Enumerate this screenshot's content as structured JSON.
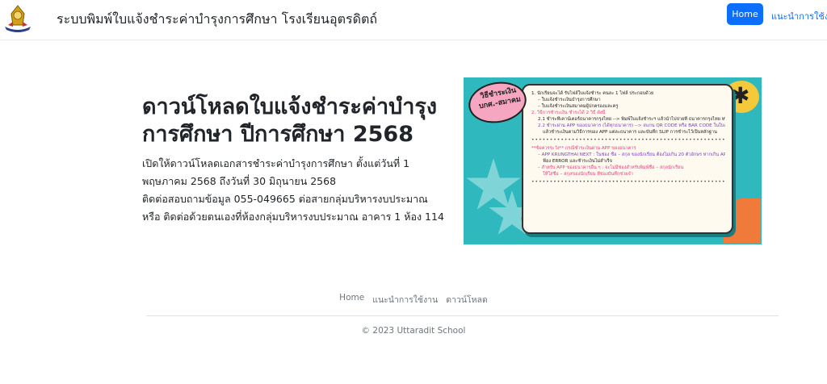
{
  "header": {
    "site_title": "ระบบพิมพ์ใบแจ้งชำระค่าบำรุงการศึกษา โรงเรียนอุตรดิตถ์",
    "nav": {
      "home": "Home",
      "guide": "แนะนำการใช้งาน"
    }
  },
  "hero": {
    "title": "ดาวน์โหลดใบแจ้งชำระค่าบำรุงการศึกษา ปีการศึกษา 2568",
    "description": [
      "เปิดให้ดาวน์โหลดเอกสารชำระค่าบำรุงการศึกษา ตั้งแต่วันที่ 1 พฤษภาคม 2568 ถึงวันที่ 30 มิถุนายน 2568",
      "ติดต่อสอบถามข้อมูล 055-049665 ต่อสายกลุ่มบริหารงบประมาณ หรือ ติดต่อด้วยตนเองที่ห้องกลุ่มบริหารงบประมาณ อาคาร 1 ห้อง 114"
    ]
  },
  "banner": {
    "bubble": "วิธีชำระเงิน บกศ.-สมาคม",
    "lines": [
      "1. นักเรียนจะได้ รับไฟล์ใบแจ้งชำระ คนละ 1 ไฟล์ ประกอบด้วย",
      "– ใบแจ้งชำระเงินบำรุงการศึกษา",
      "– ใบแจ้งชำระเงินสมาคมผู้ปกครองและครู",
      "2. วิธีการชำระเงิน ชำระได้ 2 วิธี ดังนี้",
      "2.1 ชำระที่เคาน์เตอร์ธนาคารกรุงไทย --> พิมพ์ใบแจ้งชำระฯ แล้วนำไปจ่ายที่ ธนาคารกรุงไทย หรือ",
      "2.2 ชำระผ่าน APP ของธนาคาร (ได้ทุกธนาคาร) --> สแกน QR CODE หรือ BAR CODE ในใบแจ้งฯ",
      "แล้วชำระเงินตามวิธีการของ APP แต่ละธนาคาร และบันทึก SLIP การชำระไว้เป็นหลักฐาน",
      "**ข้อควรระวัง** กรณีชำระเงินผ่าน APP ของธนาคาร",
      "– APP KRUNGTHAI NEXT : ในช่อง ชื่อ – สกุล ของนักเรียน ต้องไม่เกิน 20 ตัวอักษร หากเกิน APP จะ",
      "ฟ้อง ERROR และชำระเงินไม่สำเร็จ",
      "– สำหรับ APP ของธนาคารอื่น ๆ : จะไม่มีช่องสำหรับพิมพ์ชื่อ – สกุลนักเรียน",
      "ให้ใส่ชื่อ – สกุลของนักเรียน ที่ช่องบันทึกช่วยจำ"
    ],
    "dots": "••••••••••••••••••••••••••••••••••••••••••••••••••••••••••"
  },
  "footer": {
    "nav": [
      "Home",
      "แนะนำการใช้งาน",
      "ดาวน์โหลด"
    ],
    "copyright": "© 2023 Uttaradit School"
  },
  "colors": {
    "primary": "#0d6efd",
    "banner_bg": "#2fb9bf",
    "muted": "#6c757d"
  }
}
